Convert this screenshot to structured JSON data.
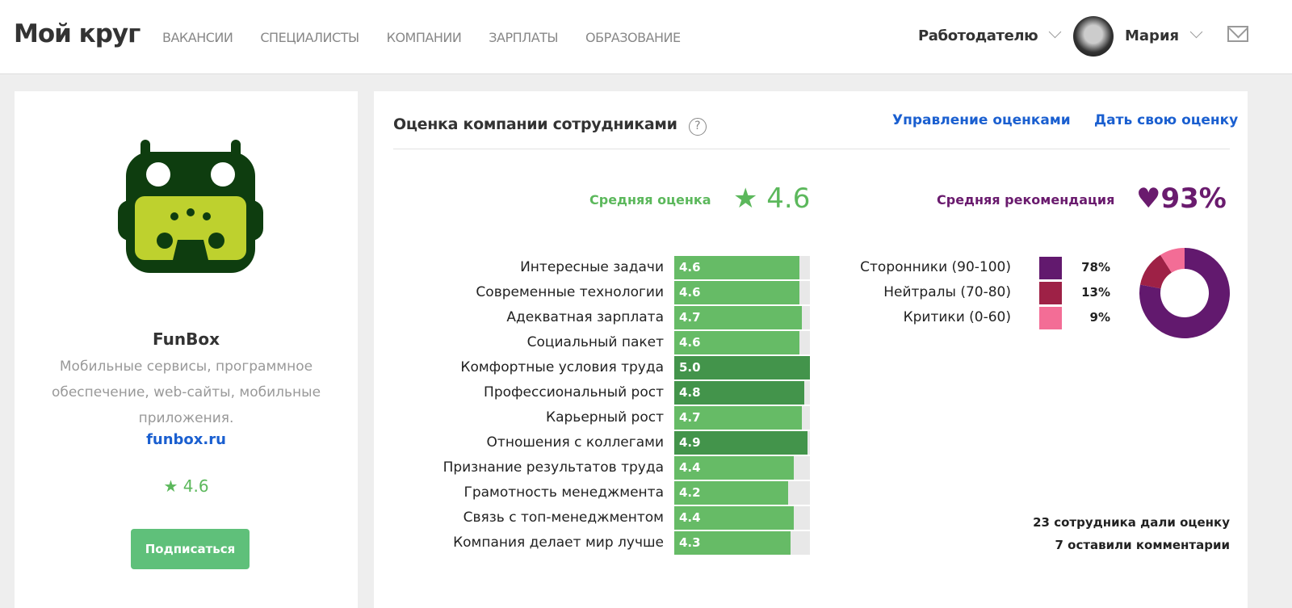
{
  "header": {
    "logo": "Мой круг",
    "nav": [
      "ВАКАНСИИ",
      "СПЕЦИАЛИСТЫ",
      "КОМПАНИИ",
      "ЗАРПЛАТЫ",
      "ОБРАЗОВАНИЕ"
    ],
    "employer": "Работодателю",
    "user": "Мария"
  },
  "company": {
    "name": "FunBox",
    "description": "Мобильные сервисы, программное обеспечение, web-сайты, мобильные приложения.",
    "link": "funbox.ru",
    "rating": "★ 4.6",
    "subscribe": "Подписаться"
  },
  "ratings": {
    "title": "Оценка компании сотрудниками",
    "help": "?",
    "manage": "Управление оценками",
    "give": "Дать свою оценку",
    "avg_label": "Средняя оценка",
    "avg_value": "4.6",
    "rec_label": "Средняя рекомендация",
    "rec_value": "93%",
    "max": 5,
    "items": [
      {
        "label": "Интересные задачи",
        "value": 4.6,
        "text": "4.6"
      },
      {
        "label": "Современные технологии",
        "value": 4.6,
        "text": "4.6"
      },
      {
        "label": "Адекватная зарплата",
        "value": 4.7,
        "text": "4.7"
      },
      {
        "label": "Социальный пакет",
        "value": 4.6,
        "text": "4.6"
      },
      {
        "label": "Комфортные условия труда",
        "value": 5.0,
        "text": "5.0"
      },
      {
        "label": "Профессиональный рост",
        "value": 4.8,
        "text": "4.8"
      },
      {
        "label": "Карьерный рост",
        "value": 4.7,
        "text": "4.7"
      },
      {
        "label": "Отношения с коллегами",
        "value": 4.9,
        "text": "4.9"
      },
      {
        "label": "Признание результатов труда",
        "value": 4.4,
        "text": "4.4"
      },
      {
        "label": "Грамотность менеджмента",
        "value": 4.2,
        "text": "4.2"
      },
      {
        "label": "Связь с топ-менеджментом",
        "value": 4.4,
        "text": "4.4"
      },
      {
        "label": "Компания делает мир лучше",
        "value": 4.3,
        "text": "4.3"
      }
    ],
    "colors": {
      "light": "#66bb66",
      "dark": "#43944b"
    },
    "groups": [
      {
        "label": "Сторонники (90-100)",
        "value": 78,
        "text": "78%",
        "color": "#62196e"
      },
      {
        "label": "Нейтралы (70-80)",
        "value": 13,
        "text": "13%",
        "color": "#9e2146"
      },
      {
        "label": "Критики (0-60)",
        "value": 9,
        "text": "9%",
        "color": "#f36d96"
      }
    ],
    "footer": [
      "23 сотрудника дали оценку",
      "7 оставили комментарии"
    ]
  }
}
